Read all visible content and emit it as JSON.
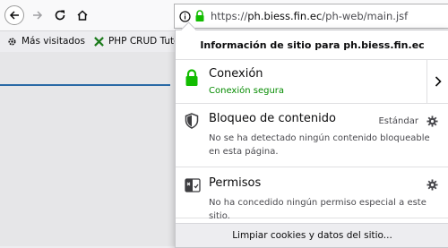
{
  "url": {
    "scheme": "https://",
    "host": "ph.biess.fin.ec",
    "path": "/ph-web/main.jsf"
  },
  "bookmarks": [
    {
      "label": "Más visitados",
      "icon": "gear-icon"
    },
    {
      "label": "PHP CRUD Tutorial (p",
      "icon": "bookmark-favicon"
    }
  ],
  "panel": {
    "header": "Información de sitio para ph.biess.fin.ec",
    "connection": {
      "title": "Conexión",
      "status": "Conexión segura"
    },
    "content_blocking": {
      "title": "Bloqueo de contenido",
      "level": "Estándar",
      "description": "No se ha detectado ningún contenido bloqueable en esta página."
    },
    "permissions": {
      "title": "Permisos",
      "description": "No ha concedido ningún permiso especial a este sitio."
    },
    "footer_button": "Limpiar cookies y datos del sitio..."
  },
  "colors": {
    "secure_green": "#12bc00",
    "secure_text": "#058b00"
  }
}
